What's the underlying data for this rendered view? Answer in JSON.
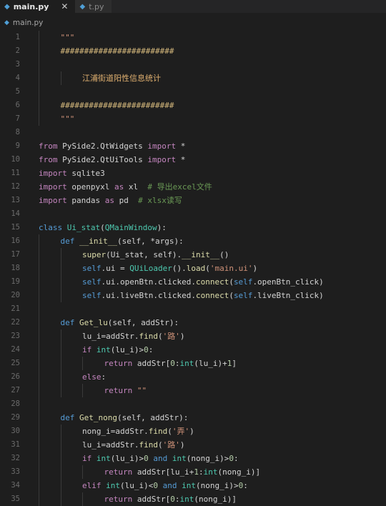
{
  "tabs": [
    {
      "label": "main.py",
      "active": true,
      "close": "✕"
    },
    {
      "label": "t.py",
      "active": false
    }
  ],
  "breadcrumb": "main.py",
  "colors": {
    "background": "#1e1e1e",
    "keyword_import": "#c586c0",
    "keyword_def": "#569cd6",
    "function": "#dcdcaa",
    "class_name": "#4ec9b0",
    "string": "#ce9178",
    "number": "#b5cea8",
    "comment": "#6a9955"
  },
  "lines": [
    {
      "n": "1",
      "indent": 1,
      "parts": [
        [
          "\"\"\"",
          "str"
        ]
      ]
    },
    {
      "n": "2",
      "indent": 1,
      "parts": [
        [
          "########################",
          "hdr"
        ]
      ]
    },
    {
      "n": "3",
      "indent": 1,
      "parts": []
    },
    {
      "n": "4",
      "indent": 2,
      "parts": [
        [
          "江浦街道阳性信息统计",
          "cjk"
        ]
      ]
    },
    {
      "n": "5",
      "indent": 1,
      "parts": []
    },
    {
      "n": "6",
      "indent": 1,
      "parts": [
        [
          "########################",
          "hdr"
        ]
      ]
    },
    {
      "n": "7",
      "indent": 1,
      "parts": [
        [
          "\"\"\"",
          "str"
        ]
      ]
    },
    {
      "n": "8",
      "indent": 0,
      "parts": []
    },
    {
      "n": "9",
      "indent": 0,
      "parts": [
        [
          "from",
          "k"
        ],
        [
          " PySide2.QtWidgets ",
          ""
        ],
        [
          "import",
          "k"
        ],
        [
          " *",
          ""
        ]
      ]
    },
    {
      "n": "10",
      "indent": 0,
      "parts": [
        [
          "from",
          "k"
        ],
        [
          " PySide2.QtUiTools ",
          ""
        ],
        [
          "import",
          "k"
        ],
        [
          " *",
          ""
        ]
      ]
    },
    {
      "n": "11",
      "indent": 0,
      "parts": [
        [
          "import",
          "k"
        ],
        [
          " sqlite3",
          ""
        ]
      ]
    },
    {
      "n": "12",
      "indent": 0,
      "parts": [
        [
          "import",
          "k"
        ],
        [
          " openpyxl ",
          ""
        ],
        [
          "as",
          "k"
        ],
        [
          " xl  ",
          ""
        ],
        [
          "# 导出excel文件",
          "cmt"
        ]
      ]
    },
    {
      "n": "13",
      "indent": 0,
      "parts": [
        [
          "import",
          "k"
        ],
        [
          " pandas ",
          ""
        ],
        [
          "as",
          "k"
        ],
        [
          " pd  ",
          ""
        ],
        [
          "# xlsx读写",
          "cmt"
        ]
      ]
    },
    {
      "n": "14",
      "indent": 0,
      "parts": []
    },
    {
      "n": "15",
      "indent": 0,
      "parts": [
        [
          "class",
          "kb"
        ],
        [
          " ",
          ""
        ],
        [
          "Ui_stat",
          "cls"
        ],
        [
          "(",
          ""
        ],
        [
          "QMainWindow",
          "cls"
        ],
        [
          "):",
          ""
        ]
      ]
    },
    {
      "n": "16",
      "indent": 1,
      "parts": [
        [
          "def",
          "kb"
        ],
        [
          " ",
          ""
        ],
        [
          "__init__",
          "fn"
        ],
        [
          "(self, *args):",
          ""
        ]
      ]
    },
    {
      "n": "17",
      "indent": 2,
      "parts": [
        [
          "super",
          "fn"
        ],
        [
          "(Ui_stat, self).",
          ""
        ],
        [
          "__init__",
          "fn"
        ],
        [
          "()",
          ""
        ]
      ]
    },
    {
      "n": "18",
      "indent": 2,
      "parts": [
        [
          "self",
          "slf"
        ],
        [
          ".ui = ",
          ""
        ],
        [
          "QUiLoader",
          "cls"
        ],
        [
          "().",
          ""
        ],
        [
          "load",
          "fn"
        ],
        [
          "(",
          ""
        ],
        [
          "'main.ui'",
          "str"
        ],
        [
          ")",
          ""
        ]
      ]
    },
    {
      "n": "19",
      "indent": 2,
      "parts": [
        [
          "self",
          "slf"
        ],
        [
          ".ui.openBtn.clicked.",
          ""
        ],
        [
          "connect",
          "fn"
        ],
        [
          "(",
          ""
        ],
        [
          "self",
          "slf"
        ],
        [
          ".openBtn_click)",
          ""
        ]
      ]
    },
    {
      "n": "20",
      "indent": 2,
      "parts": [
        [
          "self",
          "slf"
        ],
        [
          ".ui.liveBtn.clicked.",
          ""
        ],
        [
          "connect",
          "fn"
        ],
        [
          "(",
          ""
        ],
        [
          "self",
          "slf"
        ],
        [
          ".liveBtn_click)",
          ""
        ]
      ]
    },
    {
      "n": "21",
      "indent": 1,
      "parts": []
    },
    {
      "n": "22",
      "indent": 1,
      "parts": [
        [
          "def",
          "kb"
        ],
        [
          " ",
          ""
        ],
        [
          "Get_lu",
          "fn"
        ],
        [
          "(self, addStr):",
          ""
        ]
      ]
    },
    {
      "n": "23",
      "indent": 2,
      "parts": [
        [
          "lu_i=addStr.",
          ""
        ],
        [
          "find",
          "fn"
        ],
        [
          "(",
          ""
        ],
        [
          "'路'",
          "str"
        ],
        [
          ")",
          ""
        ]
      ]
    },
    {
      "n": "24",
      "indent": 2,
      "parts": [
        [
          "if",
          "k"
        ],
        [
          " ",
          ""
        ],
        [
          "int",
          "cls"
        ],
        [
          "(lu_i)>",
          ""
        ],
        [
          "0",
          "num"
        ],
        [
          ":",
          ""
        ]
      ]
    },
    {
      "n": "25",
      "indent": 3,
      "parts": [
        [
          "return",
          "k"
        ],
        [
          " addStr[",
          ""
        ],
        [
          "0",
          "num"
        ],
        [
          ":",
          ""
        ],
        [
          "int",
          "cls"
        ],
        [
          "(lu_i)+",
          ""
        ],
        [
          "1",
          "num"
        ],
        [
          "]",
          ""
        ]
      ]
    },
    {
      "n": "26",
      "indent": 2,
      "parts": [
        [
          "else",
          "k"
        ],
        [
          ":",
          ""
        ]
      ]
    },
    {
      "n": "27",
      "indent": 3,
      "parts": [
        [
          "return",
          "k"
        ],
        [
          " ",
          ""
        ],
        [
          "\"\"",
          "str"
        ]
      ]
    },
    {
      "n": "28",
      "indent": 1,
      "parts": []
    },
    {
      "n": "29",
      "indent": 1,
      "parts": [
        [
          "def",
          "kb"
        ],
        [
          " ",
          ""
        ],
        [
          "Get_nong",
          "fn"
        ],
        [
          "(self, addStr):",
          ""
        ]
      ]
    },
    {
      "n": "30",
      "indent": 2,
      "parts": [
        [
          "nong_i=addStr.",
          ""
        ],
        [
          "find",
          "fn"
        ],
        [
          "(",
          ""
        ],
        [
          "'弄'",
          "str"
        ],
        [
          ")",
          ""
        ]
      ]
    },
    {
      "n": "31",
      "indent": 2,
      "parts": [
        [
          "lu_i=addStr.",
          ""
        ],
        [
          "find",
          "fn"
        ],
        [
          "(",
          ""
        ],
        [
          "'路'",
          "str"
        ],
        [
          ")",
          ""
        ]
      ]
    },
    {
      "n": "32",
      "indent": 2,
      "parts": [
        [
          "if",
          "k"
        ],
        [
          " ",
          ""
        ],
        [
          "int",
          "cls"
        ],
        [
          "(lu_i)>",
          ""
        ],
        [
          "0",
          "num"
        ],
        [
          " ",
          ""
        ],
        [
          "and",
          "kb"
        ],
        [
          " ",
          ""
        ],
        [
          "int",
          "cls"
        ],
        [
          "(nong_i)>",
          ""
        ],
        [
          "0",
          "num"
        ],
        [
          ":",
          ""
        ]
      ]
    },
    {
      "n": "33",
      "indent": 3,
      "parts": [
        [
          "return",
          "k"
        ],
        [
          " addStr[lu_i+",
          ""
        ],
        [
          "1",
          "num"
        ],
        [
          ":",
          ""
        ],
        [
          "int",
          "cls"
        ],
        [
          "(nong_i)]",
          ""
        ]
      ]
    },
    {
      "n": "34",
      "indent": 2,
      "parts": [
        [
          "elif",
          "k"
        ],
        [
          " ",
          ""
        ],
        [
          "int",
          "cls"
        ],
        [
          "(lu_i)<",
          ""
        ],
        [
          "0",
          "num"
        ],
        [
          " ",
          ""
        ],
        [
          "and",
          "kb"
        ],
        [
          " ",
          ""
        ],
        [
          "int",
          "cls"
        ],
        [
          "(nong_i)>",
          ""
        ],
        [
          "0",
          "num"
        ],
        [
          ":",
          ""
        ]
      ]
    },
    {
      "n": "35",
      "indent": 3,
      "parts": [
        [
          "return",
          "k"
        ],
        [
          " addStr[",
          ""
        ],
        [
          "0",
          "num"
        ],
        [
          ":",
          ""
        ],
        [
          "int",
          "cls"
        ],
        [
          "(nong_i)]",
          ""
        ]
      ]
    }
  ]
}
